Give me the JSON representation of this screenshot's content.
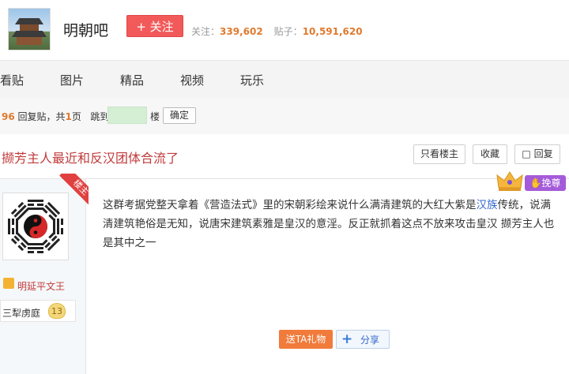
{
  "header": {
    "forum_name": "明朝吧",
    "follow_label": "+ 关注",
    "follow_count_label": "关注：",
    "follow_count": "339,602",
    "post_count_label": "贴子：",
    "post_count": "10,591,620"
  },
  "nav": {
    "items": [
      "看贴",
      "图片",
      "精品",
      "视频",
      "玩乐"
    ]
  },
  "pager": {
    "reply_count": "96",
    "reply_label": "回复贴，共",
    "page_count": "1",
    "page_label": "页",
    "jump_label": "跳到",
    "floor_label": "楼",
    "confirm_label": "确定"
  },
  "thread": {
    "title": "撷芳主人最近和反汉团体合流了",
    "only_author_label": "只看楼主",
    "favorite_label": "收藏",
    "reply_label": "回复"
  },
  "post": {
    "author_badge": "楼主",
    "username": "明延平文王",
    "bar_title": "三犁虏庭",
    "level": "13",
    "vip_label": "挽尊",
    "content_before": "这群考据党整天拿着《营造法式》里的宋朝彩绘来说什么满清建筑的大红大紫是",
    "content_link": "汉族",
    "content_after": "传统，说满清建筑艳俗是无知，说唐宋建筑素雅是皇汉的意淫。反正就抓着这点不放来攻击皇汉 撷芳主人也是其中之一",
    "gift_label": "送TA礼物",
    "share_label": "分享"
  },
  "colors": {
    "accent_red": "#f25a5a",
    "title_red": "#c13a3a",
    "number_orange": "#e07a2e",
    "link_blue": "#3366cc",
    "vip_purple": "#a45bd9"
  }
}
